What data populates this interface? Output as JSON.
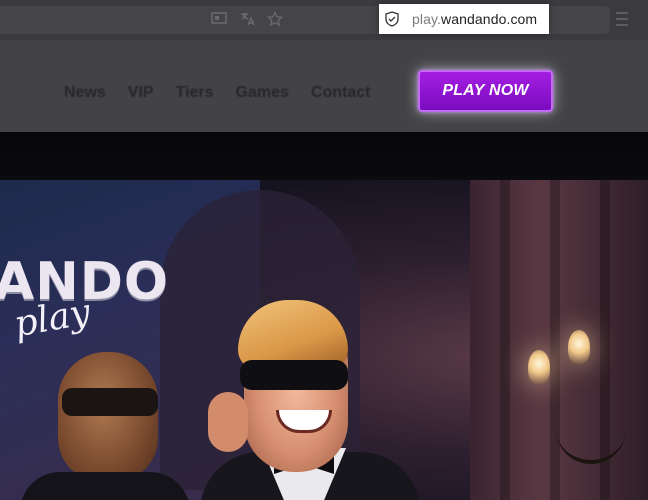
{
  "browser": {
    "url_host_dim": "play.",
    "url_host_main": "wandando.com",
    "icons": [
      "reader-view-icon",
      "translate-icon",
      "bookmark-star-icon",
      "site-security-icon",
      "menu-icon"
    ]
  },
  "header": {
    "nav_items": [
      {
        "label": "News"
      },
      {
        "label": "VIP"
      },
      {
        "label": "Tiers"
      },
      {
        "label": "Games"
      },
      {
        "label": "Contact"
      }
    ],
    "cta_label": "PLAY NOW",
    "cta_color": "#8e16d4"
  },
  "hero": {
    "logo_main": "ANDO",
    "logo_script": "play"
  }
}
